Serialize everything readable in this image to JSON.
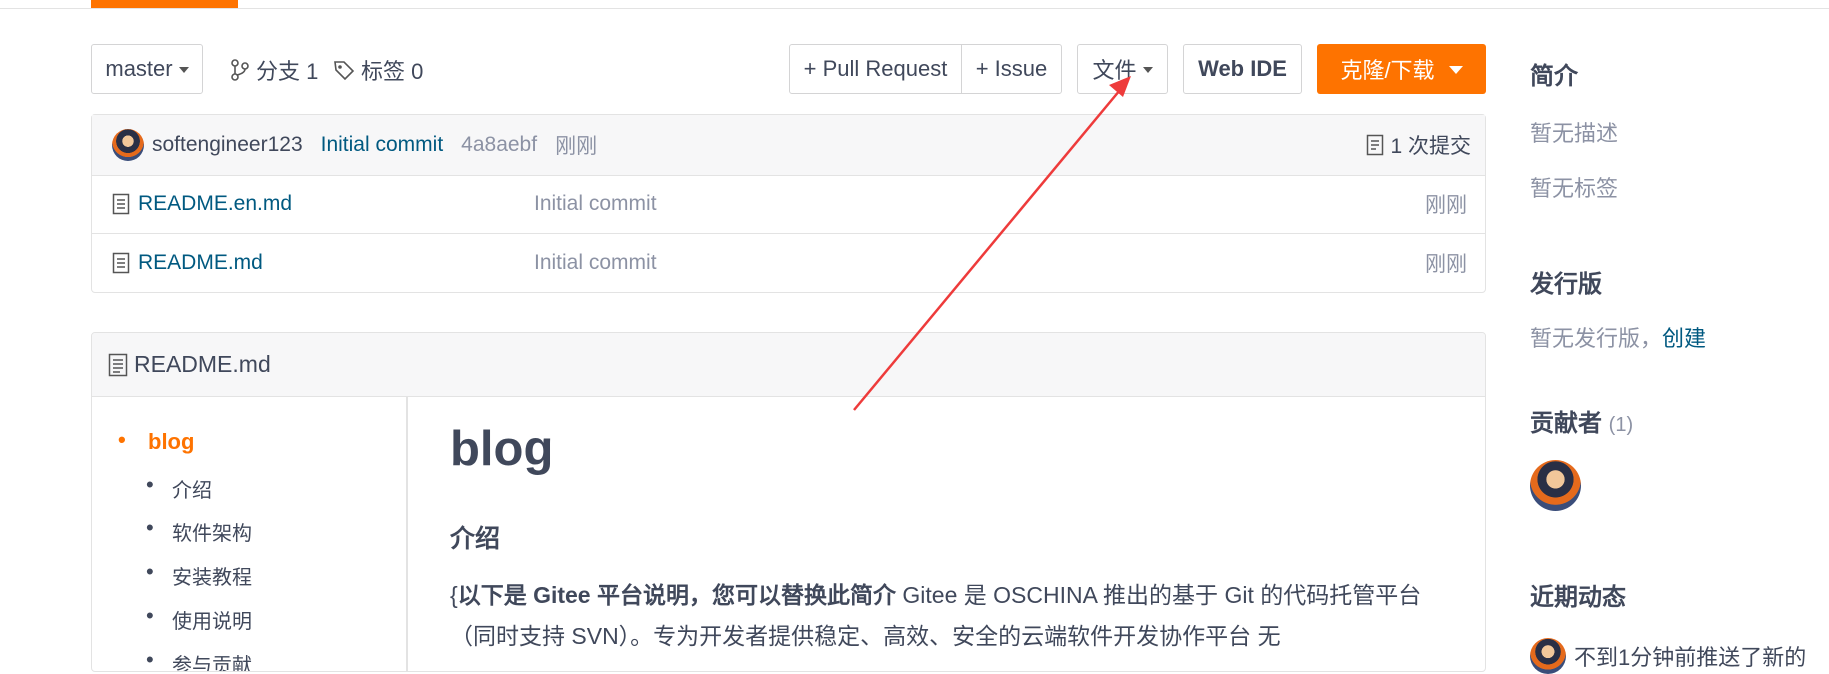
{
  "colors": {
    "accent": "#fe7300",
    "link": "#005980",
    "muted": "#8c92a4",
    "annotation": "#ee3b3b"
  },
  "toolbar": {
    "branch": "master",
    "branches_label": "分支 1",
    "tags_label": "标签 0",
    "pull_request": "+ Pull Request",
    "issue": "+ Issue",
    "file": "文件",
    "web_ide": "Web IDE",
    "clone": "克隆/下载"
  },
  "commit": {
    "user": "softengineer123",
    "message": "Initial commit",
    "sha": "4a8aebf",
    "time": "刚刚",
    "count": "1 次提交"
  },
  "files": [
    {
      "icon": "file-text-icon",
      "name": "README.en.md",
      "message": "Initial commit",
      "time": "刚刚"
    },
    {
      "icon": "file-text-icon",
      "name": "README.md",
      "message": "Initial commit",
      "time": "刚刚"
    }
  ],
  "readme": {
    "filename": "README.md",
    "toc": [
      "blog",
      "介绍",
      "软件架构",
      "安装教程",
      "使用说明",
      "参与贡献"
    ],
    "title": "blog",
    "h2": "介绍",
    "p_prefix": "{",
    "p_bold": "以下是 Gitee 平台说明，您可以替换此简介",
    "p_text": " Gitee 是 OSCHINA 推出的基于 Git 的代码托管平台（同时支持 SVN）。专为开发者提供稳定、高效、安全的云端软件开发协作平台 无"
  },
  "sidebar": {
    "intro_title": "简介",
    "no_desc": "暂无描述",
    "no_tags": "暂无标签",
    "release_title": "发行版",
    "no_release": "暂无发行版，",
    "create": "创建",
    "contributors_title": "贡献者",
    "contributors_count": "(1)",
    "activity_title": "近期动态",
    "activity_text": "不到1分钟前推送了新的"
  }
}
